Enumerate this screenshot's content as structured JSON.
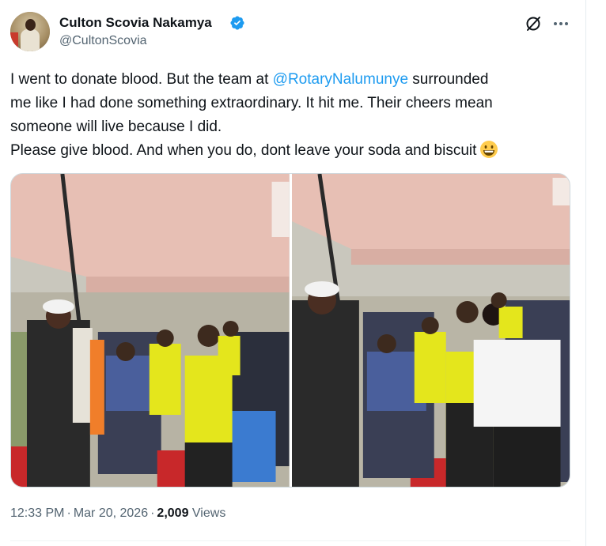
{
  "author": {
    "name": "Culton Scovia Nakamya",
    "handle": "@CultonScovia",
    "verified": true,
    "verified_color": "#1d9bf0"
  },
  "actions": {
    "grok_icon": "slashed-circle-icon",
    "more_icon": "more-horizontal-icon"
  },
  "tweet": {
    "line1_before": "I went to donate blood. But the team at ",
    "mention": "@RotaryNalumunye",
    "line1_after": " surrounded",
    "line2": "me like I had done something extraordinary.  It hit me. Their cheers mean",
    "line3": "someone will live because I did.",
    "line4": "Please give blood. And when you do, dont leave your soda and biscuit",
    "emoji": "grinning-face-emoji"
  },
  "media": {
    "count": 2,
    "photos": [
      {
        "subject": "blood donation photo 1"
      },
      {
        "subject": "blood donation photo 2"
      }
    ]
  },
  "meta": {
    "time": "12:33 PM",
    "date": "Mar 20, 2026",
    "views_count": "2,009",
    "views_label": "Views"
  },
  "colors": {
    "text": "#0f1419",
    "secondary": "#536471",
    "link": "#1d9bf0",
    "border": "#cfd9de"
  }
}
